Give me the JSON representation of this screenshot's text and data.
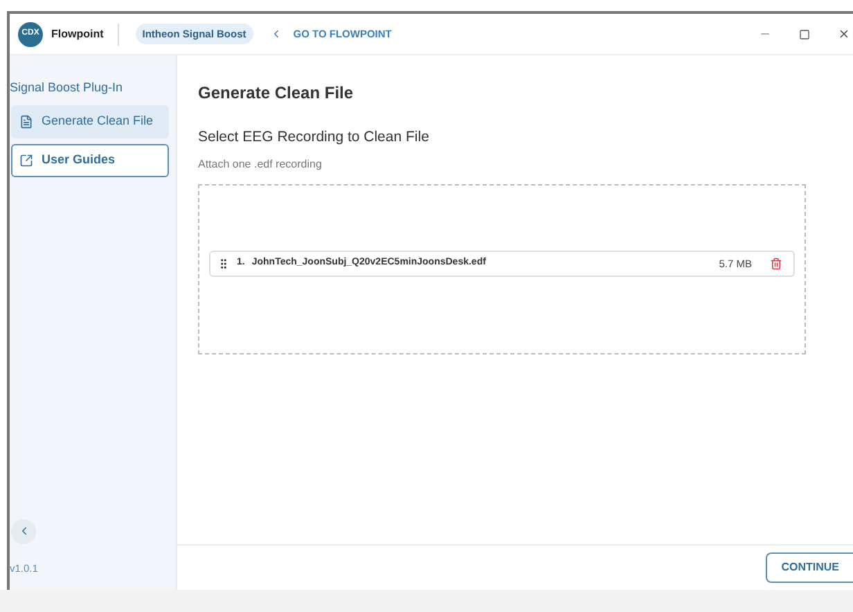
{
  "titlebar": {
    "app_name": "Flowpoint",
    "logo_text": "CDX",
    "plugin_badge": "Intheon Signal Boost",
    "back_link": "GO TO FLOWPOINT"
  },
  "sidebar": {
    "heading": "Signal Boost Plug-In",
    "items": [
      {
        "label": "Generate Clean File",
        "kind": "document",
        "selected": true,
        "focused": false
      },
      {
        "label": "User Guides",
        "kind": "external",
        "selected": false,
        "focused": true
      }
    ],
    "version": "v1.0.1"
  },
  "main": {
    "title": "Generate Clean File",
    "section_title": "Select EEG Recording to Clean File",
    "hint": "Attach one .edf recording",
    "files": [
      {
        "index": "1.",
        "name": "JohnTech_JoonSubj_Q20v2EC5minJoonsDesk.edf",
        "size": "5.7 MB"
      }
    ]
  },
  "footer": {
    "button": "CONTINUE"
  }
}
